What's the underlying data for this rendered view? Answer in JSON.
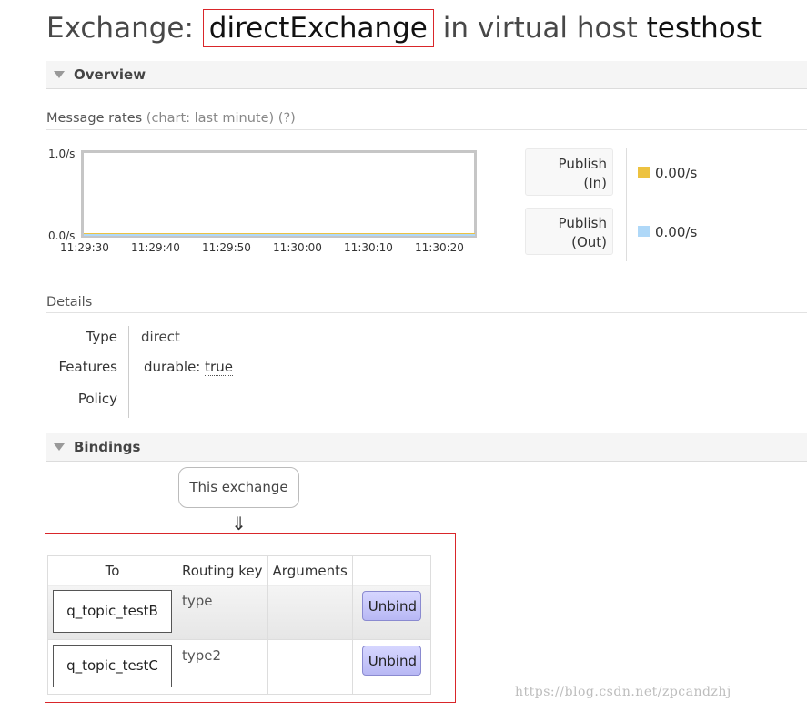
{
  "title": {
    "prefix": "Exchange:",
    "exchange_name": "directExchange",
    "middle": "in virtual host",
    "vhost": "testhost"
  },
  "overview": {
    "heading": "Overview",
    "message_rates": {
      "label": "Message rates",
      "chart_hint": "(chart: last minute)",
      "help": "(?)"
    }
  },
  "chart_data": {
    "type": "line",
    "title": "",
    "xlabel": "",
    "ylabel": "",
    "x": [
      "11:29:30",
      "11:29:40",
      "11:29:50",
      "11:30:00",
      "11:30:10",
      "11:30:20"
    ],
    "ylim": [
      0,
      1.0
    ],
    "y_tick_labels": [
      "0.0/s",
      "1.0/s"
    ],
    "series": [
      {
        "name": "Publish (In)",
        "color": "#edc240",
        "values": [
          0,
          0,
          0,
          0,
          0,
          0
        ]
      },
      {
        "name": "Publish (Out)",
        "color": "#afd8f8",
        "values": [
          0,
          0,
          0,
          0,
          0,
          0
        ]
      }
    ],
    "grid": false,
    "legend": "right"
  },
  "rates": [
    {
      "label_line1": "Publish",
      "label_line2": "(In)",
      "value": "0.00/s",
      "color": "#edc240"
    },
    {
      "label_line1": "Publish",
      "label_line2": "(Out)",
      "value": "0.00/s",
      "color": "#afd8f8"
    }
  ],
  "details": {
    "heading": "Details",
    "type_label": "Type",
    "type_value": "direct",
    "features_label": "Features",
    "features_key": "durable:",
    "features_value": "true",
    "policy_label": "Policy",
    "policy_value": ""
  },
  "bindings": {
    "heading": "Bindings",
    "source_label": "This exchange",
    "arrow": "⇓",
    "columns": [
      "To",
      "Routing key",
      "Arguments",
      ""
    ],
    "rows": [
      {
        "to": "q_topic_testB",
        "routing_key": "type",
        "arguments": "",
        "action": "Unbind"
      },
      {
        "to": "q_topic_testC",
        "routing_key": "type2",
        "arguments": "",
        "action": "Unbind"
      }
    ]
  },
  "watermark": "https://blog.csdn.net/zpcandzhj"
}
